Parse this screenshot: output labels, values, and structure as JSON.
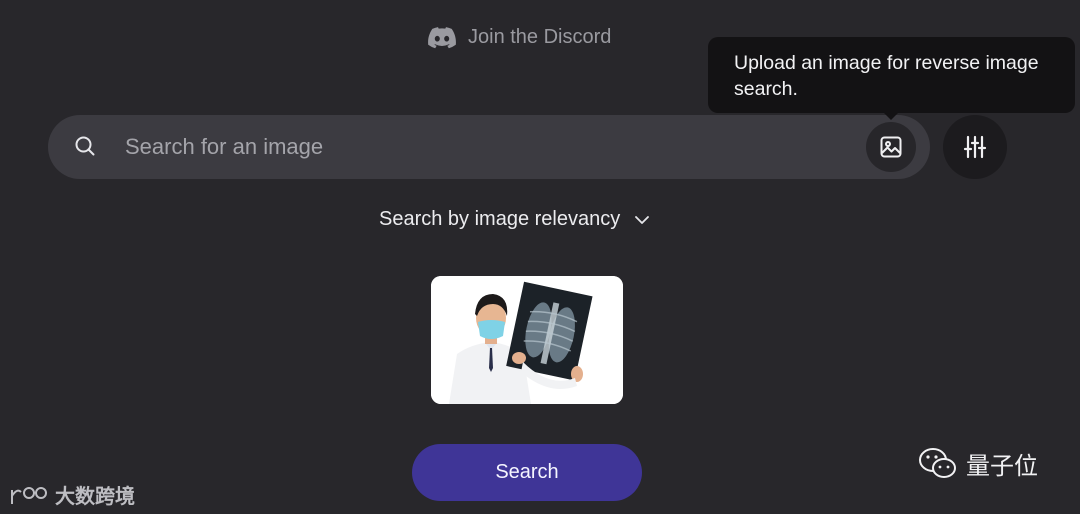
{
  "header": {
    "discord_label": "Join the Discord",
    "discord_icon": "discord-icon"
  },
  "search": {
    "placeholder": "Search for an image",
    "search_icon": "search-icon",
    "upload_icon": "image-icon",
    "filters_icon": "sliders-icon"
  },
  "tooltip": {
    "text": "Upload an image for reverse image search."
  },
  "sort": {
    "selected": "Search by image relevancy",
    "chevron_icon": "chevron-down-icon"
  },
  "preview": {
    "label": "uploaded-image"
  },
  "actions": {
    "search_label": "Search"
  },
  "watermarks": {
    "left": "大数跨境",
    "right": "量子位"
  },
  "colors": {
    "background": "#28272b",
    "search_bar": "#3c3b41",
    "accent": "#3f3597",
    "tooltip": "#131214"
  }
}
